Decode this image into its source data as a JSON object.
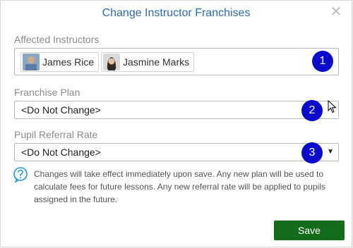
{
  "dialog": {
    "title": "Change Instructor Franchises",
    "close_glyph": "✕"
  },
  "affected": {
    "label": "Affected Instructors",
    "instructors": [
      {
        "name": "James Rice"
      },
      {
        "name": "Jasmine Marks"
      }
    ]
  },
  "plan": {
    "label": "Franchise Plan",
    "value": "<Do Not Change>"
  },
  "rate": {
    "label": "Pupil Referral Rate",
    "value": "<Do Not Change>",
    "caret": "▼"
  },
  "note": "Changes will take effect immediately upon save. Any new plan will be used to calculate fees for future lessons. Any new referral rate will be applied to pupils assigned in the future.",
  "badges": [
    "1",
    "2",
    "3"
  ],
  "actions": {
    "save_label": "Save"
  },
  "colors": {
    "title": "#2b6cb0",
    "badge": "#0b0bcc",
    "save": "#146b1a",
    "help_icon": "#1e9fd8"
  }
}
